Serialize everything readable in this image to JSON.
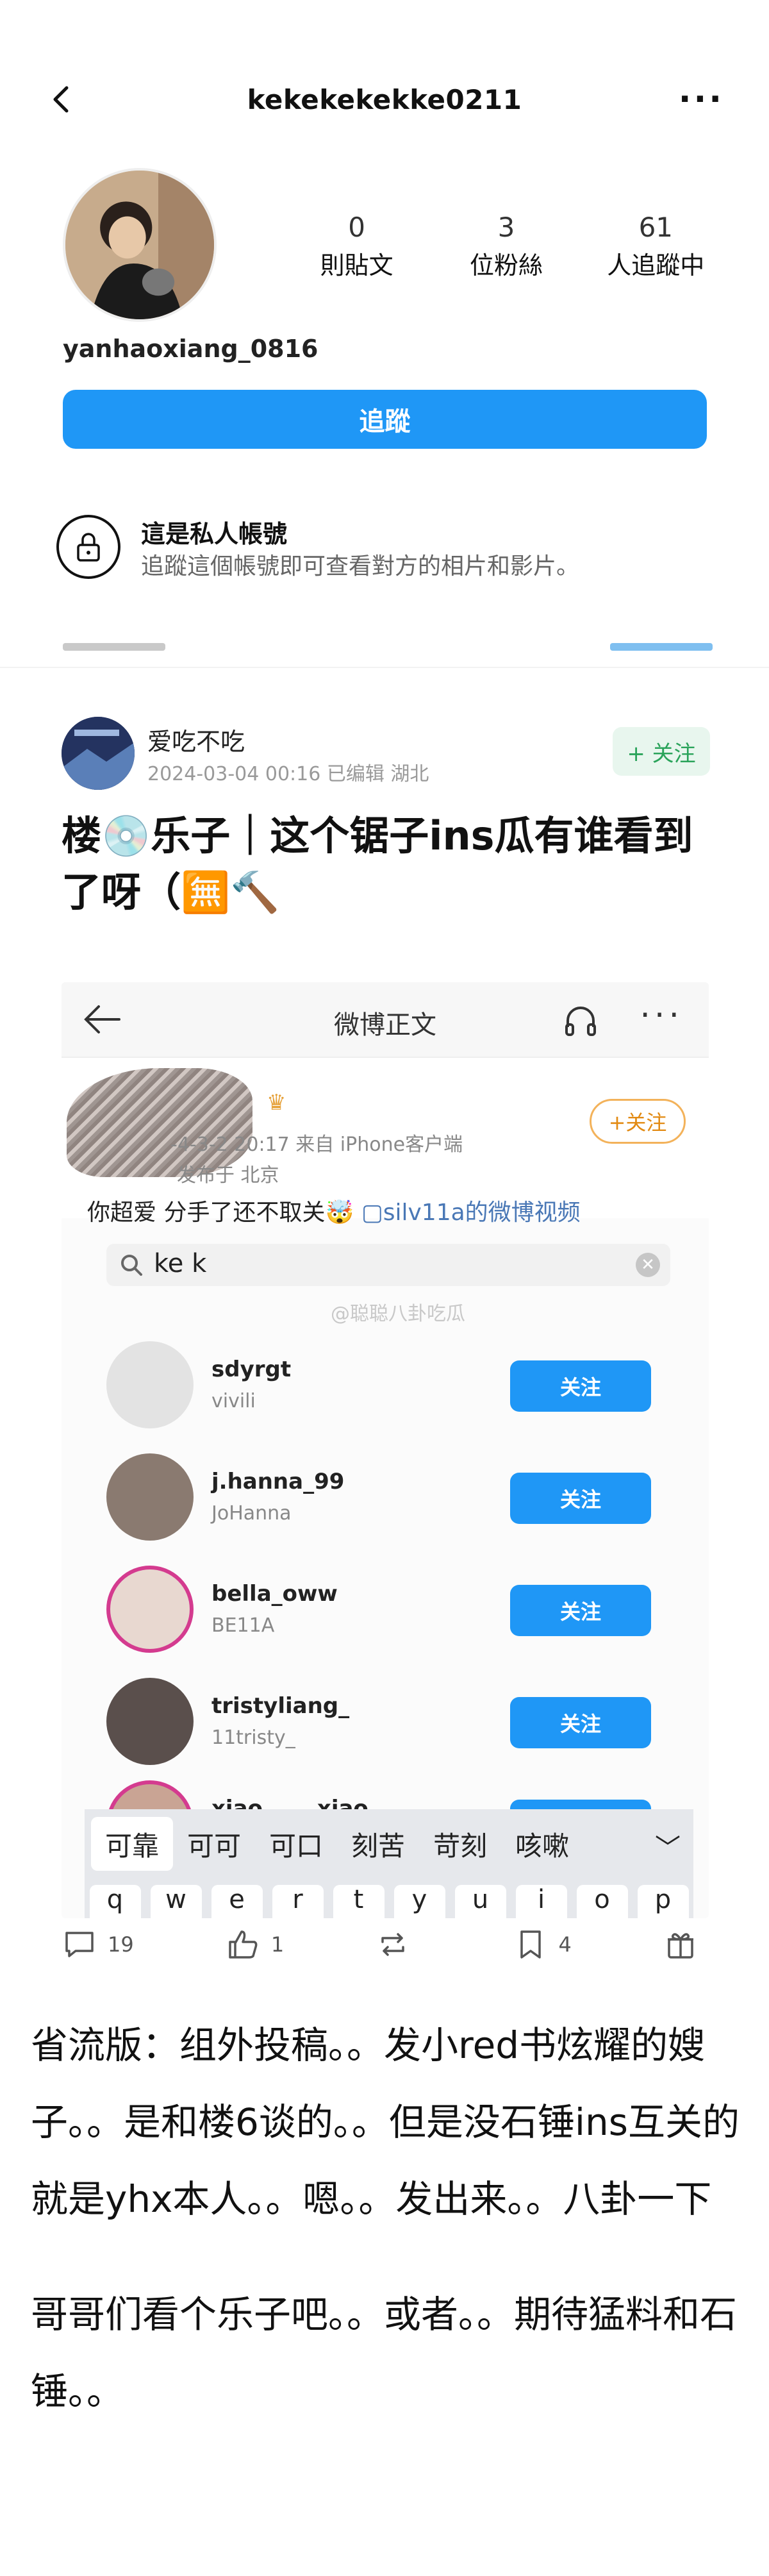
{
  "ig": {
    "title": "kekekekekke0211",
    "more": "···",
    "stats": [
      {
        "num": "0",
        "label": "則貼文"
      },
      {
        "num": "3",
        "label": "位粉絲"
      },
      {
        "num": "61",
        "label": "人追蹤中"
      }
    ],
    "handle": "yanhaoxiang_0816",
    "follow_label": "追蹤",
    "private_title": "這是私人帳號",
    "private_desc": "追蹤這個帳號即可查看對方的相片和影片。"
  },
  "post": {
    "author": "爱吃不吃",
    "meta": "2024-03-04 00:16  已编辑  湖北",
    "follow_label": "+ 关注",
    "title": "楼💿乐子｜这个锯子ins瓜有谁看到了呀（🈚🔨"
  },
  "weibo": {
    "title": "微博正文",
    "time": "-4-3-2 20:17  来自 iPhone客户端",
    "location": "发布于 北京",
    "follow_label": "+关注",
    "caption_text": "你超爱 分手了还不取关🤯 ",
    "caption_link": "▢silv11a的微博视频",
    "search_text": "ke k",
    "watermark": "@聪聪八卦吃瓜"
  },
  "accounts": [
    {
      "name": "sdyrgt",
      "sub": "vivili",
      "btn": "关注"
    },
    {
      "name": "j.hanna_99",
      "sub": "JoHanna",
      "btn": "关注"
    },
    {
      "name": "bella_oww",
      "sub": "BE11A",
      "btn": "关注"
    },
    {
      "name": "tristyliang_",
      "sub": "11tristy_",
      "btn": "关注"
    },
    {
      "name": "xiao_____xiao",
      "sub": "",
      "btn": "关注"
    }
  ],
  "ime": {
    "candidates": [
      "可靠",
      "可可",
      "可口",
      "刻苦",
      "苛刻",
      "咳嗽"
    ],
    "collapse": "﹀",
    "keys": [
      "q",
      "w",
      "e",
      "r",
      "t",
      "y",
      "u",
      "i",
      "o",
      "p"
    ]
  },
  "actions": {
    "comments": "19",
    "likes": "1",
    "saves": "4"
  },
  "body": {
    "p1": "省流版：组外投稿。。发小red书炫耀的嫂子。。是和楼6谈的。。但是没石锤ins互关的就是yhx本人。。嗯。。发出来。。八卦一下",
    "p2": "哥哥们看个乐子吧。。或者。。期待猛料和石锤。。"
  }
}
